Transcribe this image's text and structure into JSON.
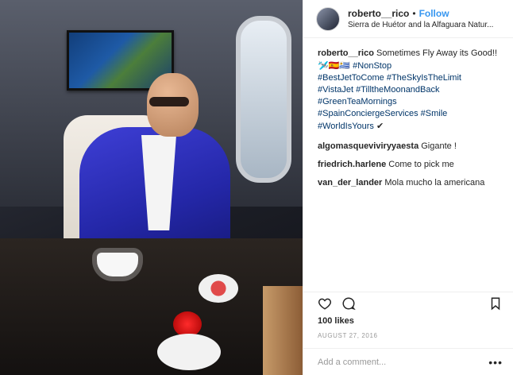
{
  "post": {
    "username": "roberto__rico",
    "follow_label": "Follow",
    "separator": "•",
    "location": "Sierra de Huétor and la Alfaguara Natur...",
    "caption_user": "roberto__rico",
    "caption_text": "Sometimes Fly Away its Good!!",
    "caption_emojis": "🛩️🇪🇸🇺🇾",
    "hashtags": [
      "#NonStop",
      "#BestJetToCome",
      "#TheSkyIsTheLimit",
      "#VistaJet",
      "#TilltheMoonandBack",
      "#GreenTeaMornings",
      "#SpainConciergeServices",
      "#Smile",
      "#WorldIsYours"
    ],
    "checkmark": "✔",
    "comments": [
      {
        "user": "algomasqueviviryyaesta",
        "text": "Gigante !"
      },
      {
        "user": "friedrich.harlene",
        "text": "Come to pick me"
      },
      {
        "user": "van_der_lander",
        "text": "Mola mucho la americana"
      }
    ],
    "likes": "100 likes",
    "date": "AUGUST 27, 2016",
    "comment_placeholder": "Add a comment...",
    "more_label": "•••"
  },
  "icons": {
    "like": "heart-icon",
    "comment": "comment-icon",
    "save": "bookmark-icon",
    "more": "more-options-icon"
  }
}
